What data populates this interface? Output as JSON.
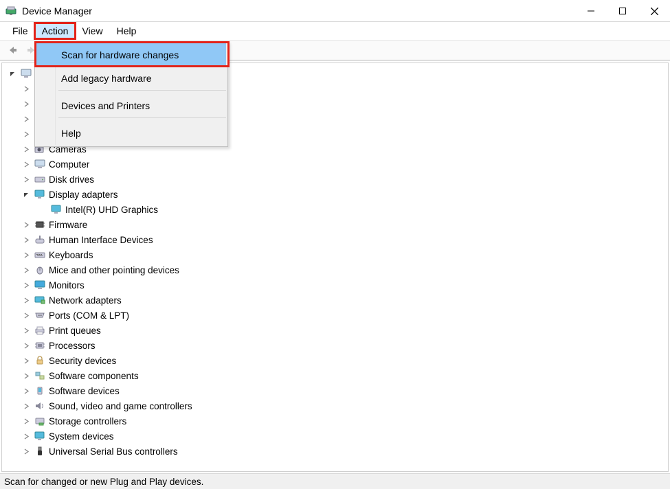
{
  "window": {
    "title": "Device Manager"
  },
  "menubar": {
    "file": "File",
    "action": "Action",
    "view": "View",
    "help": "Help"
  },
  "dropdown": {
    "scan": "Scan for hardware changes",
    "legacy": "Add legacy hardware",
    "devices": "Devices and Printers",
    "help": "Help"
  },
  "tree": {
    "root": "",
    "cameras": "Cameras",
    "computer": "Computer",
    "diskdrives": "Disk drives",
    "display": "Display adapters",
    "display_child": "Intel(R) UHD Graphics",
    "firmware": "Firmware",
    "hid": "Human Interface Devices",
    "keyboards": "Keyboards",
    "mice": "Mice and other pointing devices",
    "monitors": "Monitors",
    "network": "Network adapters",
    "ports": "Ports (COM & LPT)",
    "printqueues": "Print queues",
    "processors": "Processors",
    "security": "Security devices",
    "swcomp": "Software components",
    "swdev": "Software devices",
    "sound": "Sound, video and game controllers",
    "storage": "Storage controllers",
    "system": "System devices",
    "usb": "Universal Serial Bus controllers"
  },
  "status": "Scan for changed or new Plug and Play devices."
}
